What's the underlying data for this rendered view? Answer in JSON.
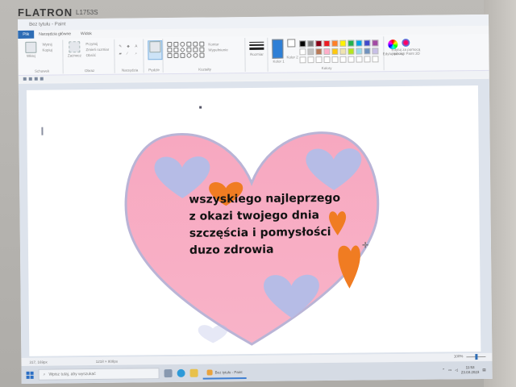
{
  "monitor": {
    "brand": "FLATRON",
    "model": "L1753S"
  },
  "window": {
    "title": "Bez tytułu - Paint"
  },
  "tabs": [
    {
      "label": "Plik",
      "active": true
    },
    {
      "label": "Narzędzia główne",
      "active": false
    },
    {
      "label": "Widok",
      "active": false
    }
  ],
  "ribbon": {
    "clipboard": {
      "paste": "Wklej",
      "cut": "Wytnij",
      "copy": "Kopiuj",
      "label": "Schowek"
    },
    "image": {
      "select": "Zaznacz",
      "crop": "Przytnij",
      "resize": "Zmień rozmiar",
      "rotate": "Obróć",
      "label": "Obraz"
    },
    "tools": {
      "label": "Narzędzia"
    },
    "brushes": {
      "label": "Pędzle"
    },
    "shapes": {
      "outline": "Kontur",
      "fill": "Wypełnienie",
      "label": "Kształty"
    },
    "size": {
      "label": "Rozmiar"
    },
    "color1": {
      "label": "Kolor 1",
      "value": "#2e7fd6"
    },
    "color2": {
      "label": "Kolor 2",
      "value": "#ffffff"
    },
    "colors": {
      "label": "Kolory",
      "palette": [
        "#000000",
        "#7f7f7f",
        "#880015",
        "#ed1c24",
        "#ff7f27",
        "#fff200",
        "#22b14c",
        "#00a2e8",
        "#3f48cc",
        "#a349a4",
        "#ffffff",
        "#c3c3c3",
        "#b97a57",
        "#ffaec9",
        "#ffc90e",
        "#efe4b0",
        "#b5e61d",
        "#99d9ea",
        "#7092be",
        "#c8bfe7",
        "#ffffff",
        "#ffffff",
        "#ffffff",
        "#ffffff",
        "#ffffff",
        "#ffffff",
        "#ffffff",
        "#ffffff",
        "#ffffff",
        "#ffffff"
      ],
      "edit": "Edytuj kolory"
    },
    "paint3d": "Edytuj za pomocą aplikacji Paint 3D"
  },
  "canvas": {
    "heart_color": "#f7a8c0",
    "heart_edge": "#b9b4d6",
    "small_heart_colors": {
      "lavender": "#b6bce6",
      "orange": "#f07c22"
    },
    "message": [
      "wszyskiego najleprzego",
      "z okazi twojego dnia",
      "szczęścia i pomysłości",
      "duzo zdrowia"
    ]
  },
  "statusbar": {
    "position": "317, 169px",
    "size": "1218 × 808px",
    "zoom": "100%"
  },
  "taskbar": {
    "search_placeholder": "Wpisz tutaj, aby wyszukać",
    "app_label": "Bez tytułu - Paint",
    "time": "11:53",
    "date": "23.03.2023"
  }
}
